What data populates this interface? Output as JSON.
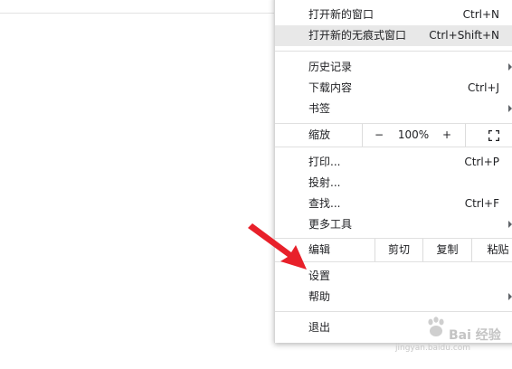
{
  "menu": {
    "items": [
      {
        "label": "打开新的窗口",
        "shortcut": "Ctrl+N"
      },
      {
        "label": "打开新的无痕式窗口",
        "shortcut": "Ctrl+Shift+N"
      },
      {
        "label": "历史记录"
      },
      {
        "label": "下载内容",
        "shortcut": "Ctrl+J"
      },
      {
        "label": "书签"
      },
      {
        "label": "打印...",
        "shortcut": "Ctrl+P"
      },
      {
        "label": "投射..."
      },
      {
        "label": "查找...",
        "shortcut": "Ctrl+F"
      },
      {
        "label": "更多工具"
      },
      {
        "label": "设置"
      },
      {
        "label": "帮助"
      },
      {
        "label": "退出"
      }
    ],
    "zoom": {
      "label": "缩放",
      "minus": "−",
      "value": "100%",
      "plus": "+",
      "fullscreen_icon": "fullscreen-icon"
    },
    "edit": {
      "label": "编辑",
      "cut": "剪切",
      "copy": "复制",
      "paste": "粘贴"
    }
  },
  "annotation": {
    "color": "#e8202a"
  },
  "watermark": {
    "brand": "Bai 经验",
    "url": "jingyan.baidu.com"
  }
}
